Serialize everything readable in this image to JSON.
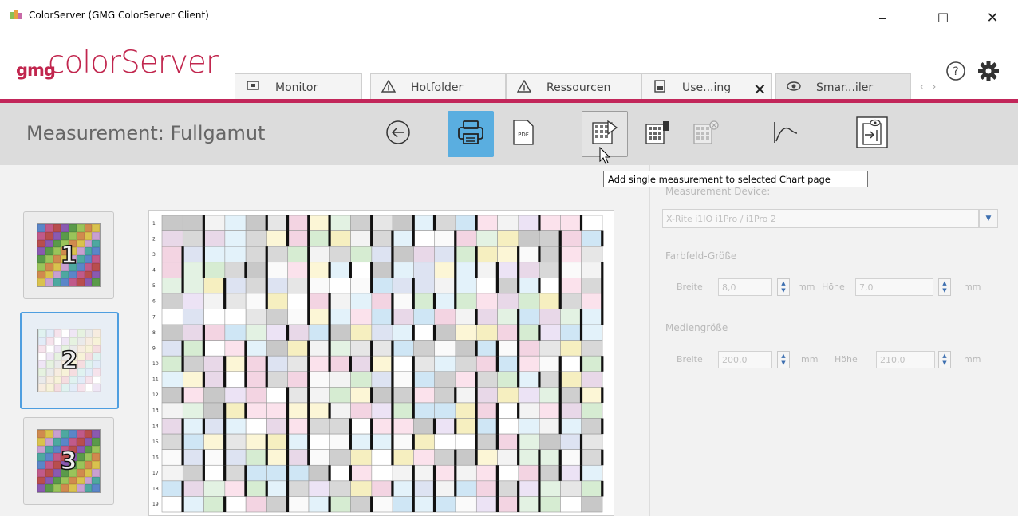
{
  "window": {
    "title": "ColorServer (GMG ColorServer Client)",
    "minimize": "–",
    "maximize": "☐",
    "close": "✕"
  },
  "header": {
    "logo_gmg": "gmg",
    "logo_text": "colorServer",
    "tabs": [
      {
        "label": "Monitor",
        "icon": "monitor-icon"
      },
      {
        "label": "Hotfolder",
        "icon": "warning-icon"
      },
      {
        "label": "Ressourcen",
        "icon": "warning-icon"
      },
      {
        "label": "Use...ing",
        "icon": "document-icon"
      },
      {
        "label": "Smar...iler",
        "icon": "eye-icon"
      }
    ],
    "tab_close": "✕",
    "tab_nav": "‹ ›",
    "help_icon": "help-icon",
    "settings_icon": "gear-icon"
  },
  "toolbar": {
    "title": "Measurement: Fullgamut",
    "buttons": [
      "back-icon",
      "print-icon",
      "pdf-icon",
      "add-measurement-icon",
      "delete-measurement-icon",
      "clear-measurement-icon",
      "curve-icon",
      "export-icon"
    ]
  },
  "tooltip": "Add single measurement to selected Chart page",
  "pages": [
    {
      "number": "1"
    },
    {
      "number": "2"
    },
    {
      "number": "3"
    }
  ],
  "chart": {
    "row_labels": [
      "1",
      "2",
      "3",
      "4",
      "5",
      "6",
      "7",
      "8",
      "9",
      "10",
      "11",
      "12",
      "13",
      "14",
      "15",
      "16",
      "17",
      "18",
      "19"
    ]
  },
  "panel": {
    "device_label": "Measurement Device:",
    "device_value": "X-Rite i1IO i1Pro / i1Pro 2",
    "patch_size_label": "Farbfeld-Größe",
    "width_label": "Breite",
    "width_value": "8,0",
    "mm1": "mm",
    "height_label": "Höhe",
    "height_value": "7,0",
    "mm2": "mm",
    "media_label": "Mediengröße",
    "media_width_label": "Breite",
    "media_width_value": "200,0",
    "mm3": "mm",
    "media_height_label": "Höhe",
    "media_height_value": "210,0",
    "mm4": "mm"
  },
  "colors": {
    "brand": "#c1264e",
    "selected": "#5aaee0",
    "toolbar_bg": "#dcdcdc"
  }
}
